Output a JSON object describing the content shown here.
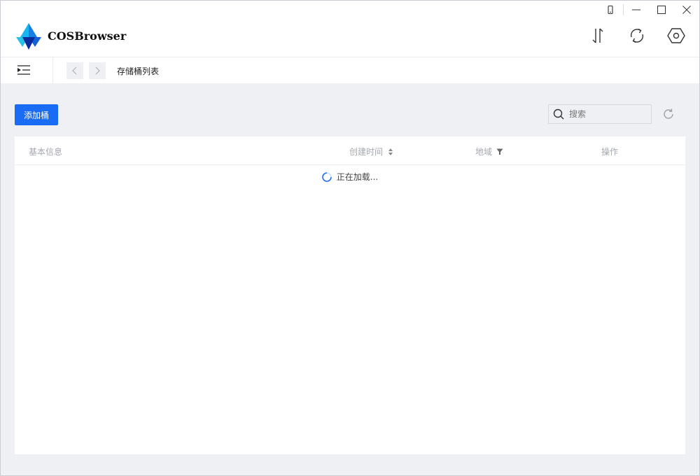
{
  "app": {
    "title": "COSBrowser"
  },
  "window_controls": {
    "icons": [
      "phone-icon",
      "minimize-icon",
      "maximize-icon",
      "close-icon"
    ]
  },
  "header": {
    "icons": [
      "transfer-icon",
      "sync-icon",
      "settings-hex-icon"
    ]
  },
  "nav": {
    "breadcrumb": "存储桶列表"
  },
  "toolbar": {
    "add_bucket_label": "添加桶",
    "search_placeholder": "搜索"
  },
  "table": {
    "columns": {
      "info": "基本信息",
      "created": "创建时间",
      "region": "地域",
      "actions": "操作"
    },
    "loading_text": "正在加载..."
  },
  "colors": {
    "accent": "#1a6cf5",
    "content_bg": "#eef0f4",
    "header_text": "#a4a8b0"
  }
}
